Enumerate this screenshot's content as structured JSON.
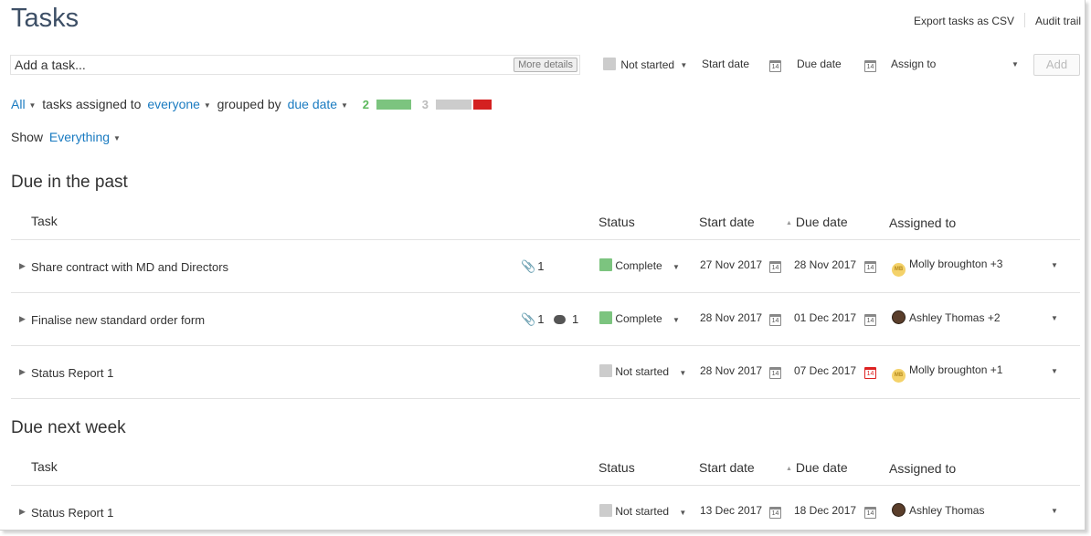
{
  "page": {
    "title": "Tasks"
  },
  "header_links": {
    "export": "Export tasks as CSV",
    "audit": "Audit trail"
  },
  "add_task": {
    "placeholder": "Add a task...",
    "more_details": "More details",
    "status_value": "Not started",
    "start_date_label": "Start date",
    "due_date_label": "Due date",
    "assign_to_label": "Assign to",
    "add_button": "Add",
    "calendar_day": "14"
  },
  "filters": {
    "all": "All",
    "assigned_text": "tasks assigned to",
    "assignee": "everyone",
    "grouped_text": "grouped by",
    "group_by": "due date",
    "count_green": "2",
    "count_grey": "3",
    "show_label": "Show",
    "show_value": "Everything"
  },
  "columns": {
    "task": "Task",
    "status": "Status",
    "start_date": "Start date",
    "due_date": "Due date",
    "assigned_to": "Assigned to"
  },
  "sections": [
    {
      "title": "Due in the past",
      "rows": [
        {
          "name": "Share contract with MD and Directors",
          "attachments": "1",
          "comments": "",
          "status": "Complete",
          "status_color": "#7cc47f",
          "start": "27 Nov 2017",
          "due": "28 Nov 2017",
          "due_overdue": false,
          "avatar": "MB",
          "assignee": "Molly broughton +3"
        },
        {
          "name": "Finalise new standard order form",
          "attachments": "1",
          "comments": "1",
          "status": "Complete",
          "status_color": "#7cc47f",
          "start": "28 Nov 2017",
          "due": "01 Dec 2017",
          "due_overdue": false,
          "avatar": "",
          "assignee": "Ashley Thomas +2"
        },
        {
          "name": "Status Report 1",
          "attachments": "",
          "comments": "",
          "status": "Not started",
          "status_color": "#cccccc",
          "start": "28 Nov 2017",
          "due": "07 Dec 2017",
          "due_overdue": true,
          "avatar": "MB",
          "assignee": "Molly broughton +1"
        }
      ]
    },
    {
      "title": "Due next week",
      "rows": [
        {
          "name": "Status Report 1",
          "attachments": "",
          "comments": "",
          "status": "Not started",
          "status_color": "#cccccc",
          "start": "13 Dec 2017",
          "due": "18 Dec 2017",
          "due_overdue": false,
          "avatar": "",
          "assignee": "Ashley Thomas"
        }
      ]
    }
  ],
  "colors": {
    "link": "#1a7bc1",
    "complete": "#7cc47f",
    "not_started": "#cccccc",
    "overdue": "#d42020"
  }
}
